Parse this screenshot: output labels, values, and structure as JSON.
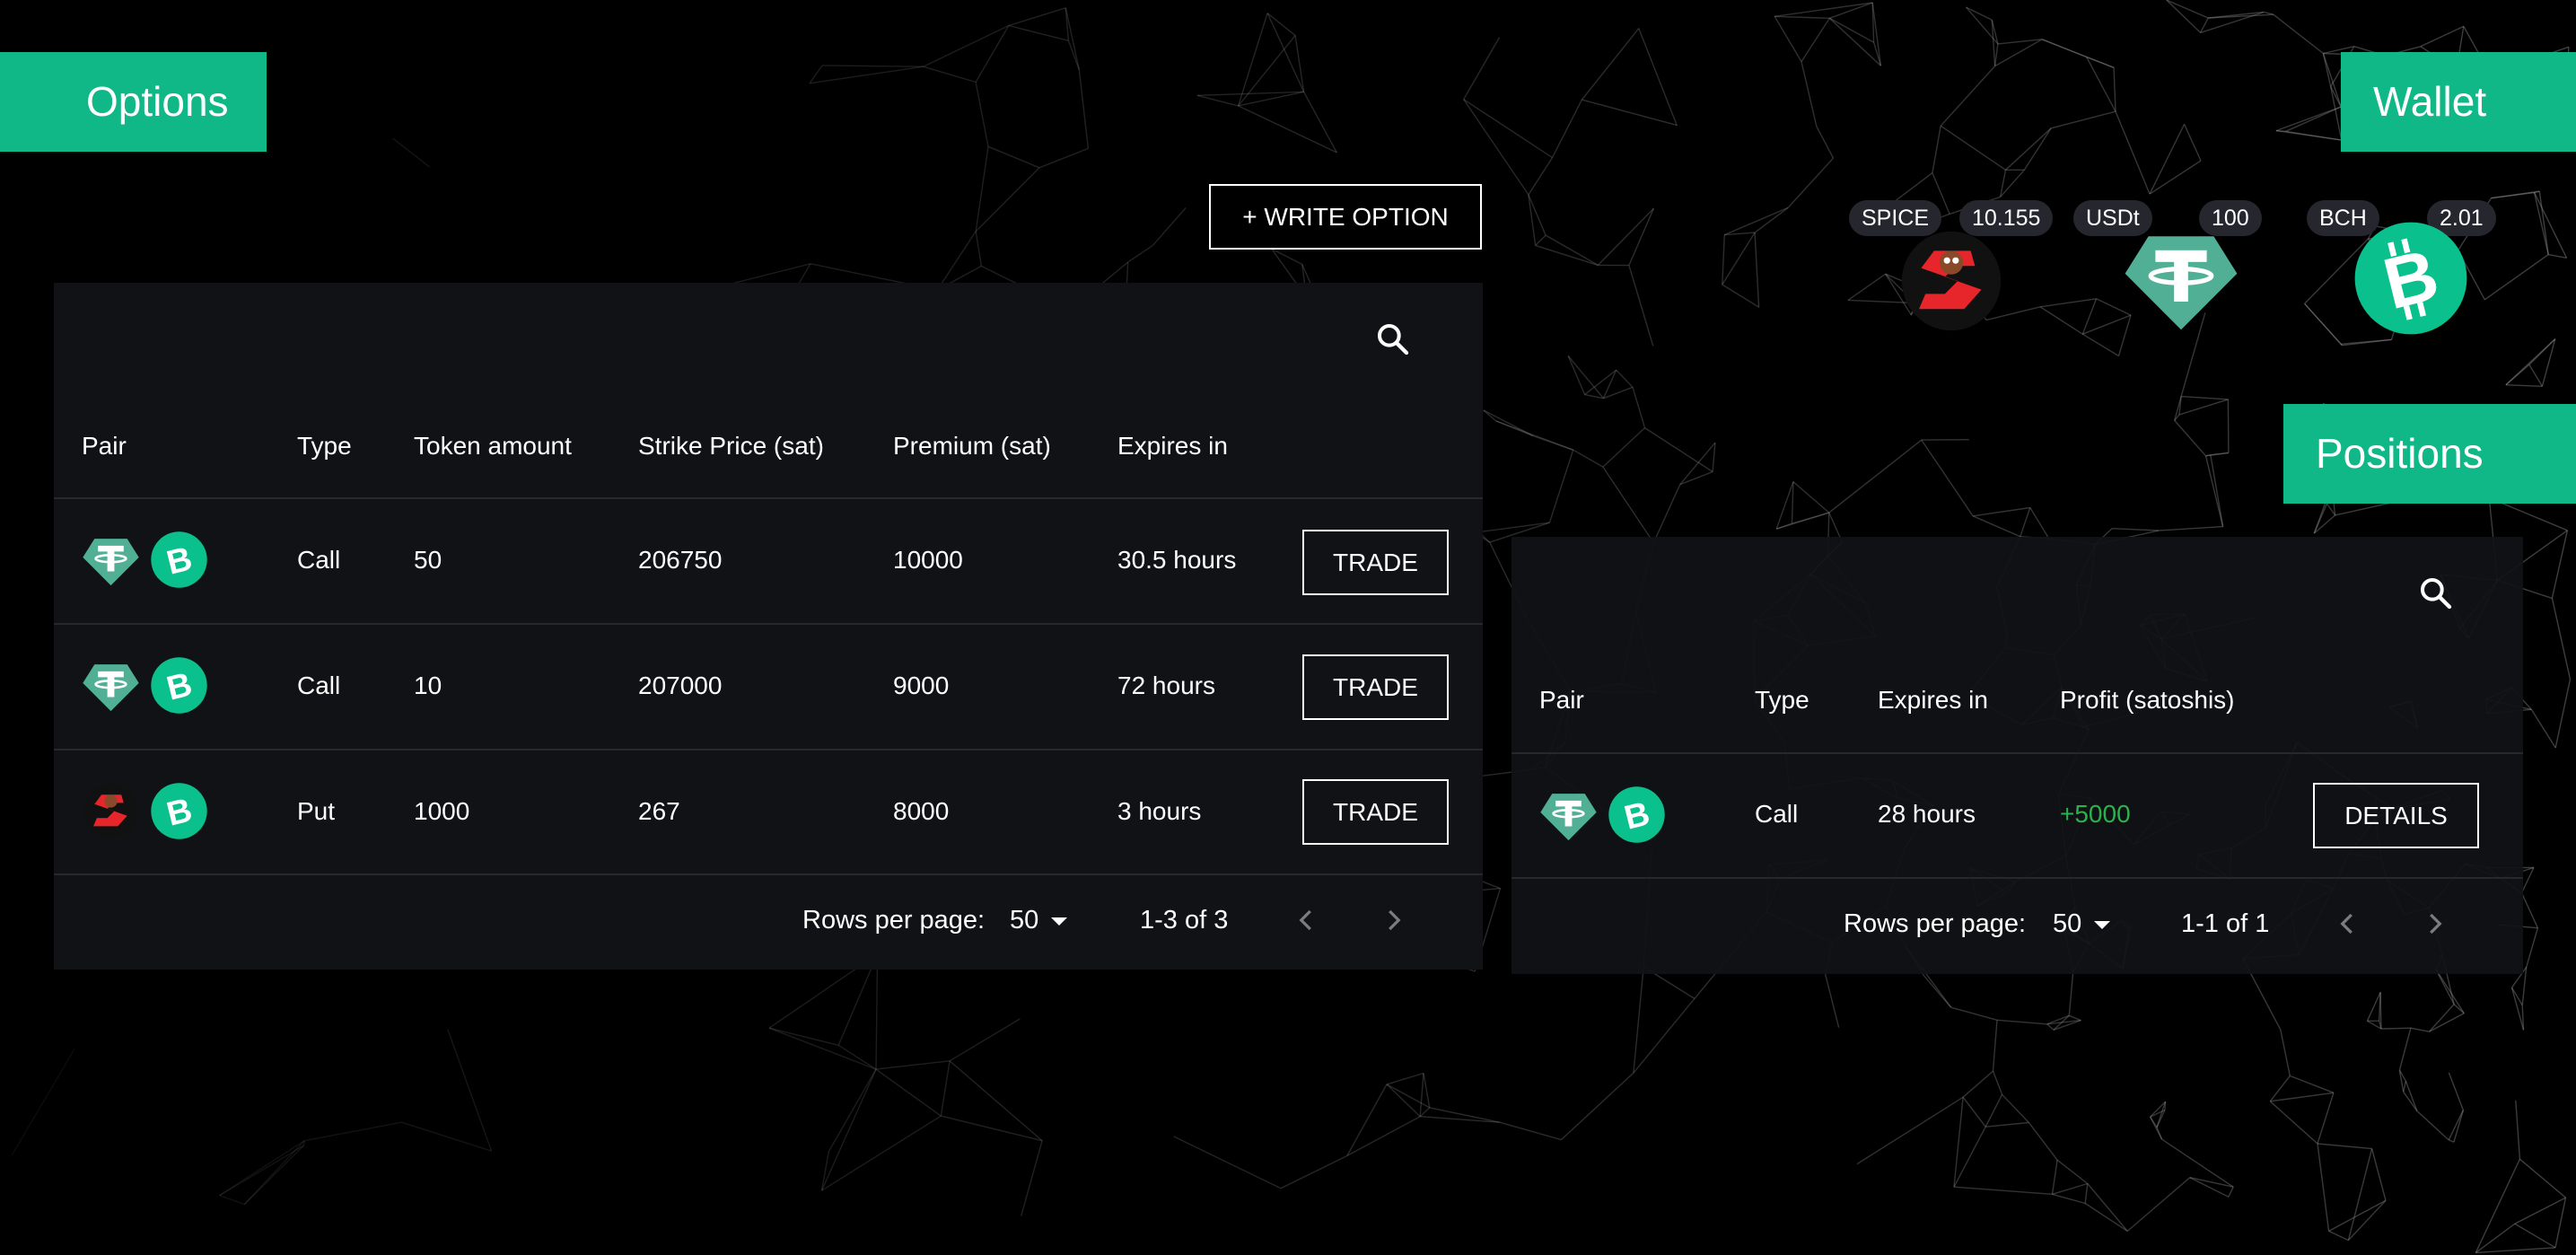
{
  "header": {
    "options_title": "Options",
    "wallet_title": "Wallet",
    "positions_title": "Positions",
    "write_option_label": "+ WRITE OPTION"
  },
  "wallet": [
    {
      "symbol": "SPICE",
      "balance": "10.155",
      "icon": "spice-icon"
    },
    {
      "symbol": "USDt",
      "balance": "100",
      "icon": "tether-icon"
    },
    {
      "symbol": "BCH",
      "balance": "2.01",
      "icon": "bch-icon"
    }
  ],
  "options_table": {
    "columns": [
      "Pair",
      "Type",
      "Token amount",
      "Strike Price (sat)",
      "Premium (sat)",
      "Expires in"
    ],
    "rows": [
      {
        "pair": [
          "tether-icon",
          "bch-icon"
        ],
        "type": "Call",
        "token_amount": "50",
        "strike": "206750",
        "premium": "10000",
        "expires": "30.5 hours",
        "action": "TRADE"
      },
      {
        "pair": [
          "tether-icon",
          "bch-icon"
        ],
        "type": "Call",
        "token_amount": "10",
        "strike": "207000",
        "premium": "9000",
        "expires": "72 hours",
        "action": "TRADE"
      },
      {
        "pair": [
          "spice-icon",
          "bch-icon"
        ],
        "type": "Put",
        "token_amount": "1000",
        "strike": "267",
        "premium": "8000",
        "expires": "3 hours",
        "action": "TRADE"
      }
    ],
    "pagination": {
      "rows_label": "Rows per page:",
      "rows_value": "50",
      "range": "1-3 of 3"
    }
  },
  "positions_table": {
    "columns": [
      "Pair",
      "Type",
      "Expires in",
      "Profit (satoshis)"
    ],
    "rows": [
      {
        "pair": [
          "tether-icon",
          "bch-icon"
        ],
        "type": "Call",
        "expires": "28 hours",
        "profit": "+5000",
        "action": "DETAILS"
      }
    ],
    "pagination": {
      "rows_label": "Rows per page:",
      "rows_value": "50",
      "range": "1-1 of 1"
    }
  },
  "colors": {
    "accent": "#10b887",
    "panel": "#111216",
    "profit_positive": "#2bb24c",
    "badge": "#26272e"
  }
}
